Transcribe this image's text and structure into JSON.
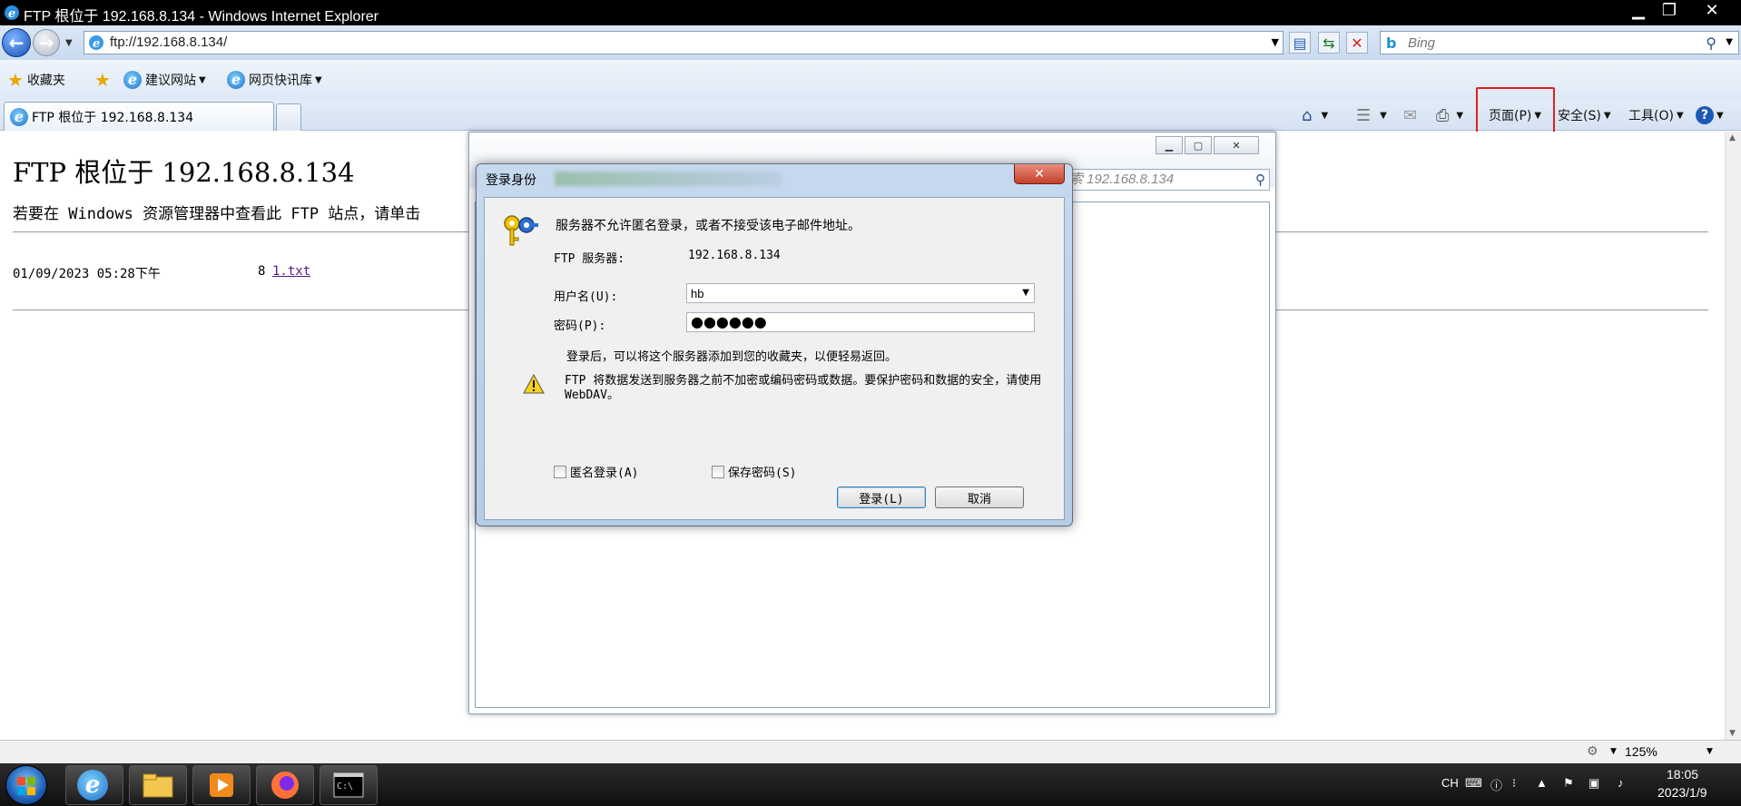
{
  "window": {
    "title": "FTP 根位于 192.168.8.134 - Windows Internet Explorer"
  },
  "nav": {
    "address": "ftp://192.168.8.134/",
    "search_placeholder": "Bing"
  },
  "favorites": {
    "label": "收藏夹",
    "items": [
      {
        "label": "建议网站"
      },
      {
        "label": "网页快讯库"
      }
    ]
  },
  "tabs": [
    {
      "label": "FTP 根位于 192.168.8.134",
      "active": true
    }
  ],
  "command_bar": {
    "page": "页面(P)",
    "safety": "安全(S)",
    "tools": "工具(O)",
    "highlighted": "page",
    "highlight_color": "#e02020"
  },
  "page": {
    "heading": "FTP 根位于 192.168.8.134",
    "instruction": "若要在 Windows 资源管理器中查看此 FTP 站点，请单击",
    "files": [
      {
        "date": "01/09/2023 05:28下午",
        "size": "8",
        "name": "1.txt"
      }
    ]
  },
  "background_window": {
    "search_text": "索 192.168.8.134"
  },
  "login_dialog": {
    "title": "登录身份",
    "message": "服务器不允许匿名登录，或者不接受该电子邮件地址。",
    "ftp_server_label": "FTP 服务器:",
    "ftp_server_value": "192.168.8.134",
    "username_label": "用户名(U):",
    "username_value": "hb",
    "password_label": "密码(P):",
    "password_mask": "●●●●●●",
    "favorites_note": "登录后，可以将这个服务器添加到您的收藏夹，以便轻易返回。",
    "warning": "FTP 将数据发送到服务器之前不加密或编码密码或数据。要保护密码和数据的安全，请使用 WebDAV。",
    "anonymous_label": "匿名登录(A)",
    "anonymous_checked": false,
    "save_password_label": "保存密码(S)",
    "save_password_checked": false,
    "login_button": "登录(L)",
    "cancel_button": "取消"
  },
  "status_bar": {
    "zoom": "125%"
  },
  "taskbar": {
    "lang": "CH",
    "time": "18:05",
    "date": "2023/1/9"
  }
}
